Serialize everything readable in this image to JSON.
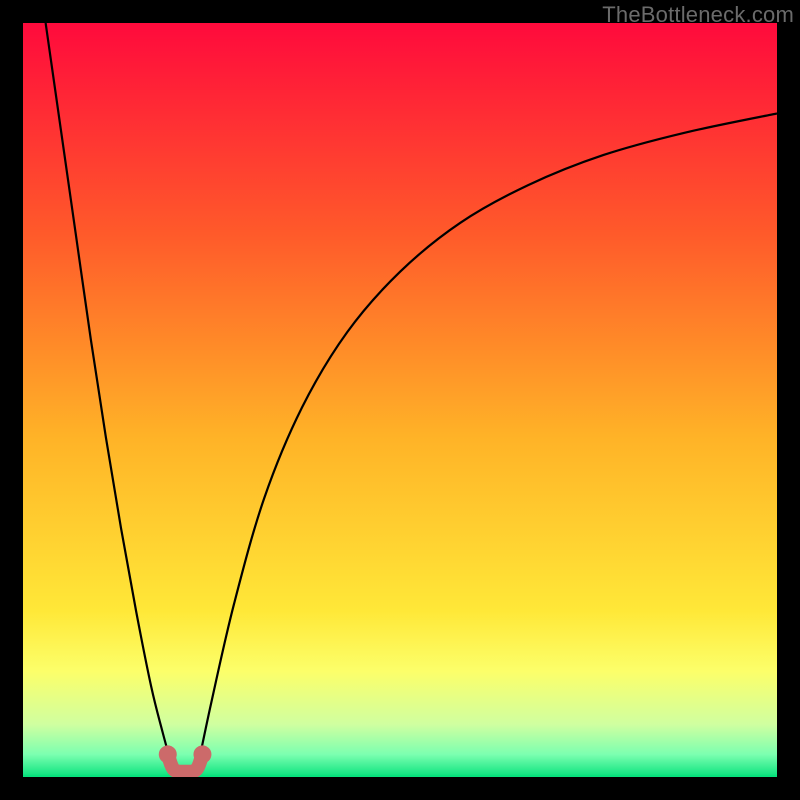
{
  "watermark": "TheBottleneck.com",
  "chart_data": {
    "type": "line",
    "title": "",
    "xlabel": "",
    "ylabel": "",
    "xlim": [
      0,
      100
    ],
    "ylim": [
      0,
      100
    ],
    "grid": false,
    "legend": false,
    "background_gradient": {
      "stops": [
        {
          "offset": 0.0,
          "color": "#ff0a3c"
        },
        {
          "offset": 0.28,
          "color": "#ff5a2a"
        },
        {
          "offset": 0.55,
          "color": "#ffb327"
        },
        {
          "offset": 0.78,
          "color": "#ffe838"
        },
        {
          "offset": 0.86,
          "color": "#fcff6a"
        },
        {
          "offset": 0.93,
          "color": "#d0ffa0"
        },
        {
          "offset": 0.97,
          "color": "#7cffb0"
        },
        {
          "offset": 1.0,
          "color": "#08e27d"
        }
      ]
    },
    "series": [
      {
        "name": "curve-left",
        "color": "#000000",
        "x": [
          3.0,
          5.0,
          7.0,
          9.0,
          11.0,
          13.0,
          15.0,
          17.0,
          18.5,
          20.0
        ],
        "y": [
          100.0,
          86.0,
          72.0,
          58.0,
          45.0,
          33.0,
          22.0,
          12.0,
          6.0,
          0.5
        ]
      },
      {
        "name": "curve-right",
        "color": "#000000",
        "x": [
          23.0,
          25.0,
          28.0,
          32.0,
          37.0,
          43.0,
          50.0,
          58.0,
          67.0,
          77.0,
          88.0,
          100.0
        ],
        "y": [
          0.5,
          10.0,
          23.0,
          37.0,
          49.0,
          59.0,
          67.0,
          73.5,
          78.5,
          82.5,
          85.5,
          88.0
        ]
      },
      {
        "name": "marker-band",
        "type": "scatter",
        "color": "#cc6a6a",
        "x": [
          19.2,
          20.0,
          21.5,
          23.0,
          23.8
        ],
        "y": [
          3.0,
          1.0,
          0.7,
          1.0,
          3.0
        ]
      }
    ],
    "floor": {
      "y": 0.3,
      "color": "#08e27d"
    }
  }
}
